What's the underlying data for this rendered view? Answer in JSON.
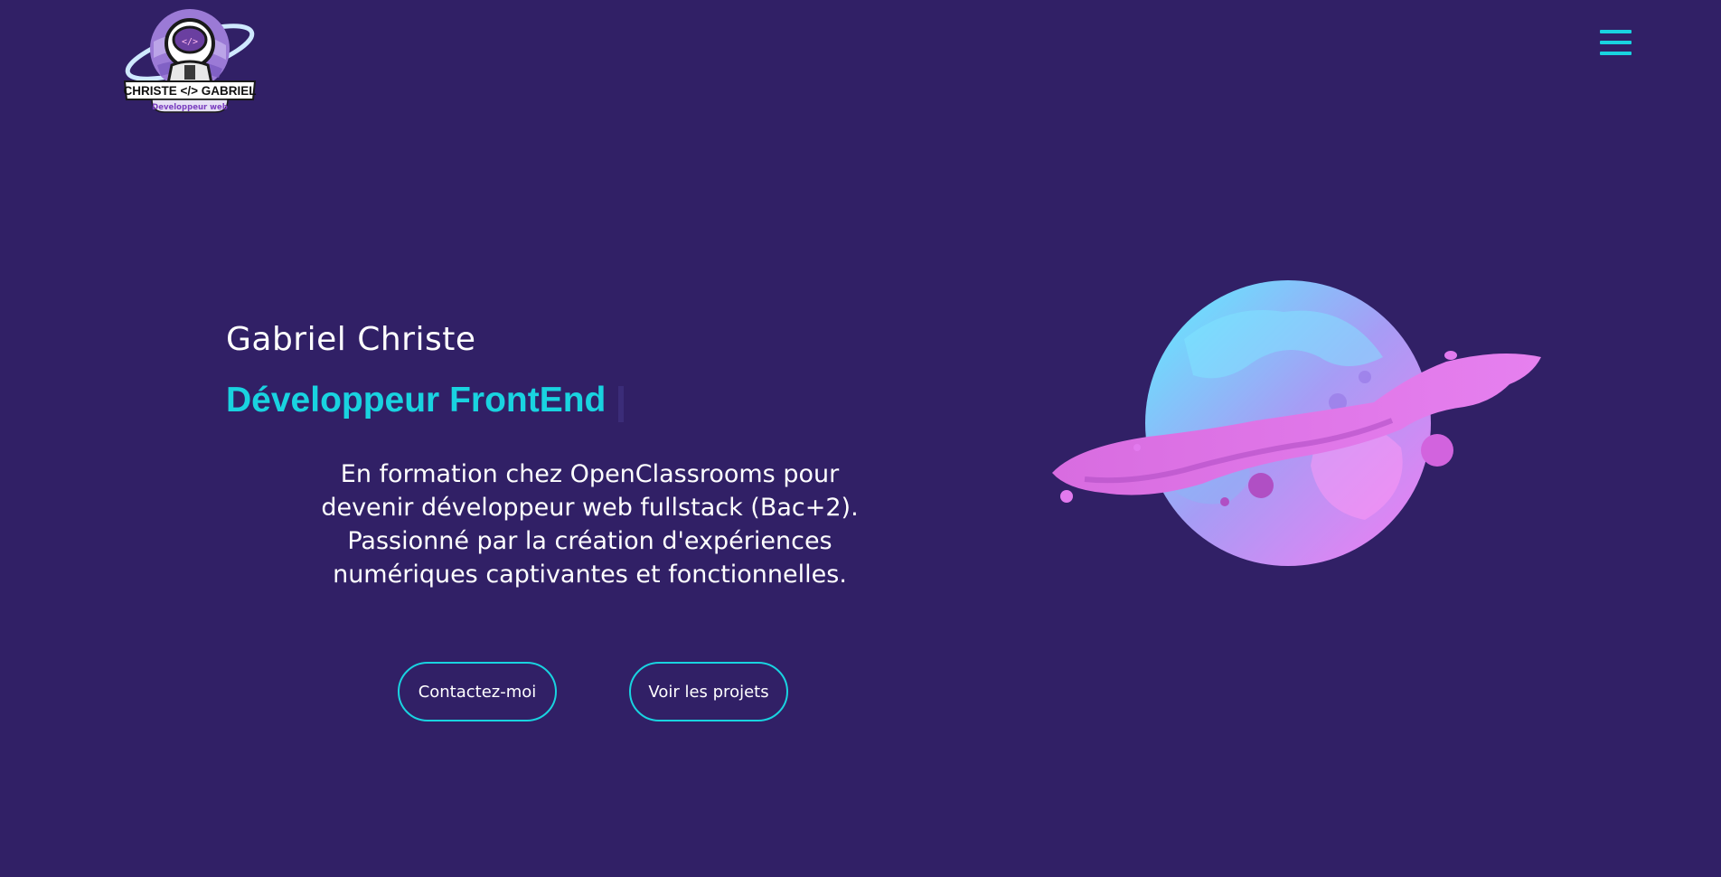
{
  "header": {
    "logo_name": "CHRISTE </> GABRIEL",
    "logo_tagline": "Developpeur web",
    "logo_code_glyph": "</>",
    "menu_icon": "hamburger-menu-icon"
  },
  "hero": {
    "name": "Gabriel Christe",
    "role": "Développeur FrontEnd",
    "description": "En formation chez OpenClassrooms pour devenir développeur web fullstack (Bac+2). Passionné par la création d'expériences numériques captivantes et fonctionnelles.",
    "buttons": {
      "contact": "Contactez-moi",
      "projects": "Voir les projets"
    },
    "illustration": "planet-illustration"
  },
  "colors": {
    "background": "#312066",
    "accent": "#19d3e0",
    "text": "#ffffff",
    "planet_pink": "#e46cf0",
    "planet_cyan": "#5cf0ff"
  }
}
